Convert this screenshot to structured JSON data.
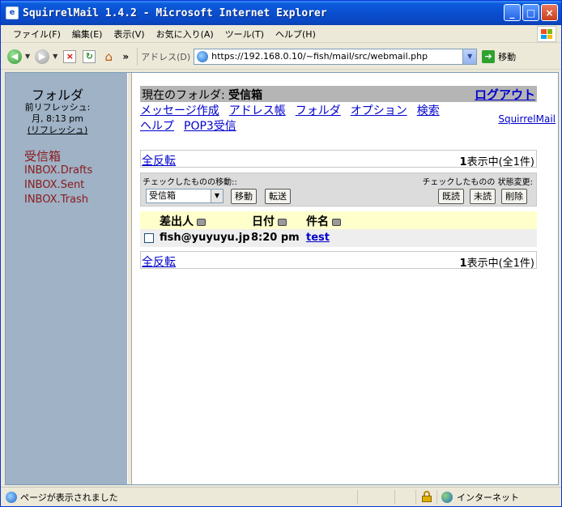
{
  "window": {
    "title": "SquirrelMail 1.4.2 - Microsoft Internet Explorer",
    "minimize": "_",
    "maximize": "□",
    "close": "×"
  },
  "menu": [
    "ファイル(F)",
    "編集(E)",
    "表示(V)",
    "お気に入り(A)",
    "ツール(T)",
    "ヘルプ(H)"
  ],
  "toolbar": {
    "chevron": "»",
    "address_label": "アドレス(D)",
    "url": "https://192.168.0.10/~fish/mail/src/webmail.php",
    "go_label": "移動"
  },
  "left": {
    "title": "フォルダ",
    "refresh_label": "前リフレッシュ:",
    "refresh_time": "月, 8:13 pm",
    "refresh_link": "(リフレッシュ)",
    "folders": [
      "受信箱",
      "INBOX.Drafts",
      "INBOX.Sent",
      "INBOX.Trash"
    ]
  },
  "main": {
    "current_label": "現在のフォルダ:",
    "current_name": "受信箱",
    "logout": "ログアウト",
    "nav": [
      "メッセージ作成",
      "アドレス帳",
      "フォルダ",
      "オプション",
      "検索",
      "ヘルプ",
      "POP3受信"
    ],
    "brand": "SquirrelMail",
    "toggle_all": "全反転",
    "count_prefix": "1",
    "count_text": "表示中(全1件)",
    "move_label": "チェックしたものの移動::",
    "status_label": "チェックしたものの 状態変更:",
    "move_select": "受信箱",
    "move_btn": "移動",
    "forward_btn": "転送",
    "read_btn": "既読",
    "unread_btn": "未読",
    "delete_btn": "削除",
    "columns": {
      "from": "差出人",
      "date": "日付",
      "subject": "件名"
    },
    "messages": [
      {
        "from": "fish@yuyuyu.jp",
        "date": "8:20 pm",
        "subject": "test"
      }
    ]
  },
  "status": {
    "text": "ページが表示されました",
    "zone": "インターネット"
  }
}
